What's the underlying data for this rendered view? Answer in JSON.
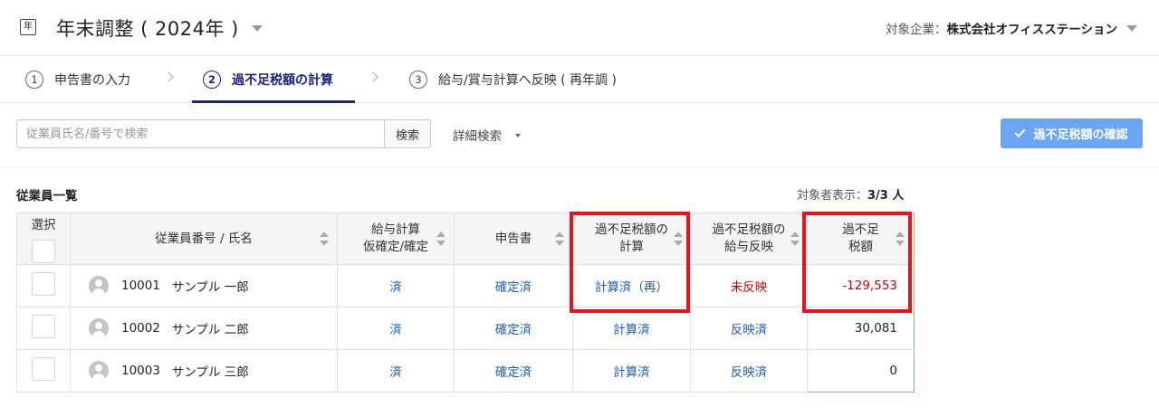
{
  "header": {
    "app_icon_glyph": "年",
    "title": "年末調整 ( 2024年 )",
    "company_label": "対象企業：",
    "company_name": "株式会社オフィスステーション"
  },
  "steps": [
    {
      "num": "1",
      "label": "申告書の入力"
    },
    {
      "num": "2",
      "label": "過不足税額の計算",
      "active": true
    },
    {
      "num": "3",
      "label": "給与/賞与計算へ反映 ( 再年調 )"
    }
  ],
  "search": {
    "placeholder": "従業員氏名/番号で検索",
    "button_label": "検索",
    "advanced_label": "詳細検索",
    "confirm_label": "過不足税額の確認"
  },
  "list": {
    "title": "従業員一覧",
    "count_label": "対象者表示：",
    "count_value": "3/3 人"
  },
  "table": {
    "headers": {
      "select": "選択",
      "employee": "従業員番号 / 氏名",
      "payroll_line1": "給与計算",
      "payroll_line2": "仮確定/確定",
      "declaration": "申告書",
      "calc_line1": "過不足税額の",
      "calc_line2": "計算",
      "reflect_line1": "過不足税額の",
      "reflect_line2": "給与反映",
      "amount_line1": "過不足",
      "amount_line2": "税額"
    },
    "rows": [
      {
        "emp_no": "10001",
        "name": "サンプル 一郎",
        "payroll": "済",
        "declaration": "確定済",
        "calc": "計算済（再）",
        "reflect": "未反映",
        "amount": "-129,553"
      },
      {
        "emp_no": "10002",
        "name": "サンプル 二郎",
        "payroll": "済",
        "declaration": "確定済",
        "calc": "計算済",
        "reflect": "反映済",
        "amount": "30,081"
      },
      {
        "emp_no": "10003",
        "name": "サンプル 三郎",
        "payroll": "済",
        "declaration": "確定済",
        "calc": "計算済",
        "reflect": "反映済",
        "amount": "0"
      }
    ]
  },
  "colors": {
    "accent": "#1a237e",
    "link": "#1e5eb5",
    "negative": "#d10000",
    "confirm_button": "#6aa6f3",
    "highlight": "#e8141b"
  }
}
